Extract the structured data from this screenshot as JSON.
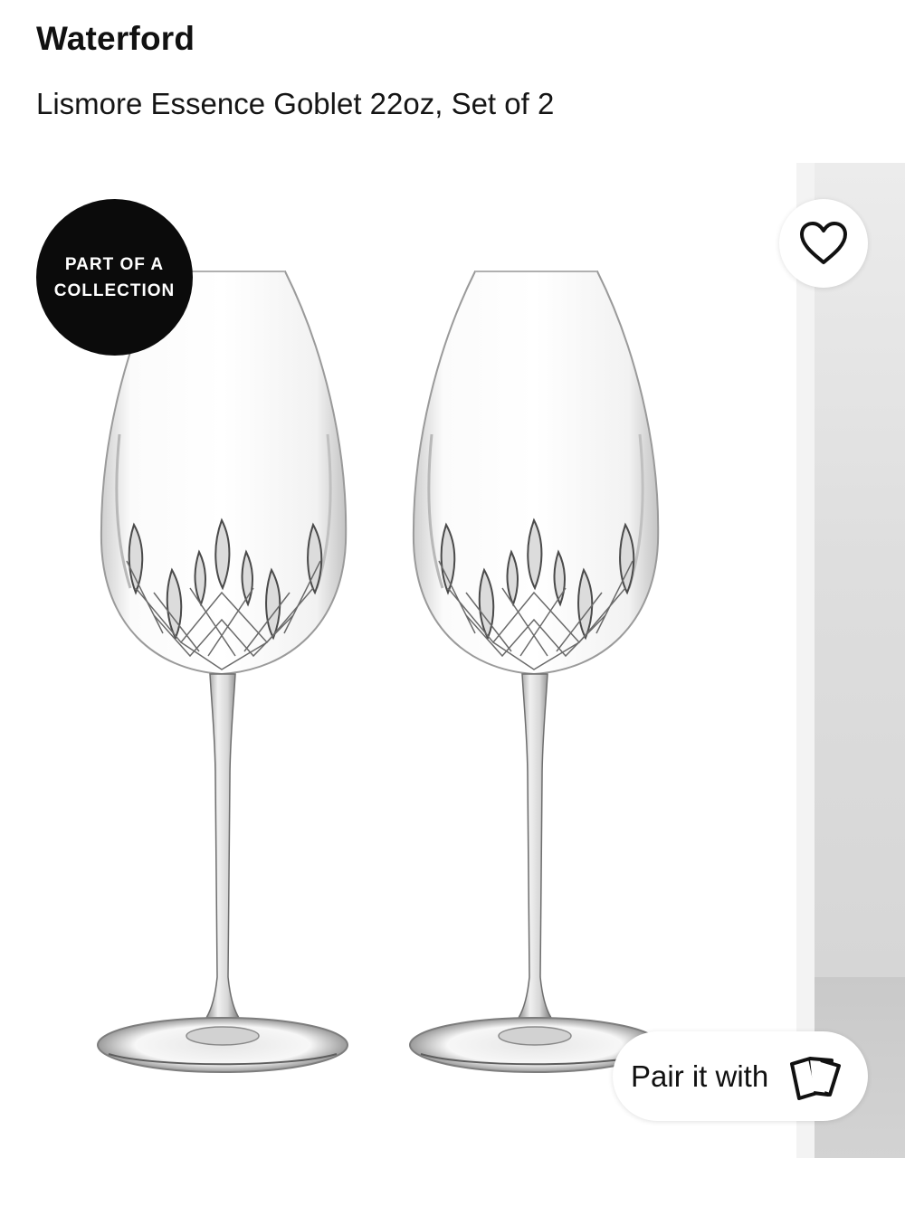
{
  "product": {
    "brand": "Waterford",
    "name": "Lismore Essence Goblet 22oz, Set of 2"
  },
  "gallery": {
    "badge": {
      "line1": "PART OF A",
      "line2": "COLLECTION"
    },
    "wishlist_icon": "heart-outline-icon",
    "pair_button": {
      "label": "Pair it with",
      "icon": "cards-icon"
    }
  },
  "colors": {
    "text": "#111111",
    "badge_background": "#0b0b0b",
    "badge_text": "#ffffff",
    "button_background": "#ffffff"
  }
}
